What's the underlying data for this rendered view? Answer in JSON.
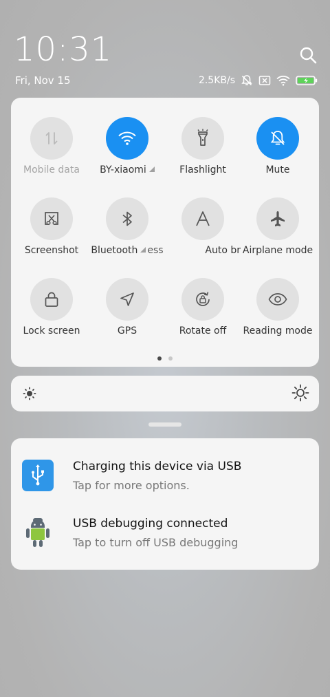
{
  "status": {
    "time": "10:31",
    "date": "Fri, Nov 15",
    "speed": "2.5KB/s"
  },
  "quick_settings": {
    "tiles": [
      {
        "label": "Mobile data",
        "icon": "mobile-data-icon",
        "state": "off"
      },
      {
        "label": "BY-xiaomi",
        "icon": "wifi-icon",
        "state": "on",
        "has_signal": true
      },
      {
        "label": "Flashlight",
        "icon": "flashlight-icon",
        "state": "neutral"
      },
      {
        "label": "Mute",
        "icon": "mute-icon",
        "state": "on"
      },
      {
        "label": "Screenshot",
        "icon": "screenshot-icon",
        "state": "neutral"
      },
      {
        "label": "Bluetooth",
        "icon": "bluetooth-icon",
        "state": "neutral",
        "has_signal": true
      },
      {
        "label": "ess",
        "icon": "",
        "state": "neutral"
      },
      {
        "label": "Auto br",
        "icon": "auto-brightness-icon",
        "state": "neutral"
      },
      {
        "label": "Airplane mode",
        "icon": "airplane-icon",
        "state": "neutral"
      },
      {
        "label": "Lock screen",
        "icon": "lock-icon",
        "state": "neutral"
      },
      {
        "label": "GPS",
        "icon": "gps-icon",
        "state": "neutral"
      },
      {
        "label": "Rotate off",
        "icon": "rotate-lock-icon",
        "state": "neutral"
      },
      {
        "label": "Reading mode",
        "icon": "eye-icon",
        "state": "neutral"
      }
    ],
    "page_count": 2,
    "active_page": 1
  },
  "notifications": [
    {
      "title": "Charging this device via USB",
      "text": "Tap for more options.",
      "icon": "usb-icon"
    },
    {
      "title": "USB debugging connected",
      "text": "Tap to turn off USB debugging",
      "icon": "android-debug-icon"
    }
  ],
  "colors": {
    "accent": "#1a90f2",
    "panel": "#f5f5f5",
    "tile_off": "#e1e1e1"
  }
}
